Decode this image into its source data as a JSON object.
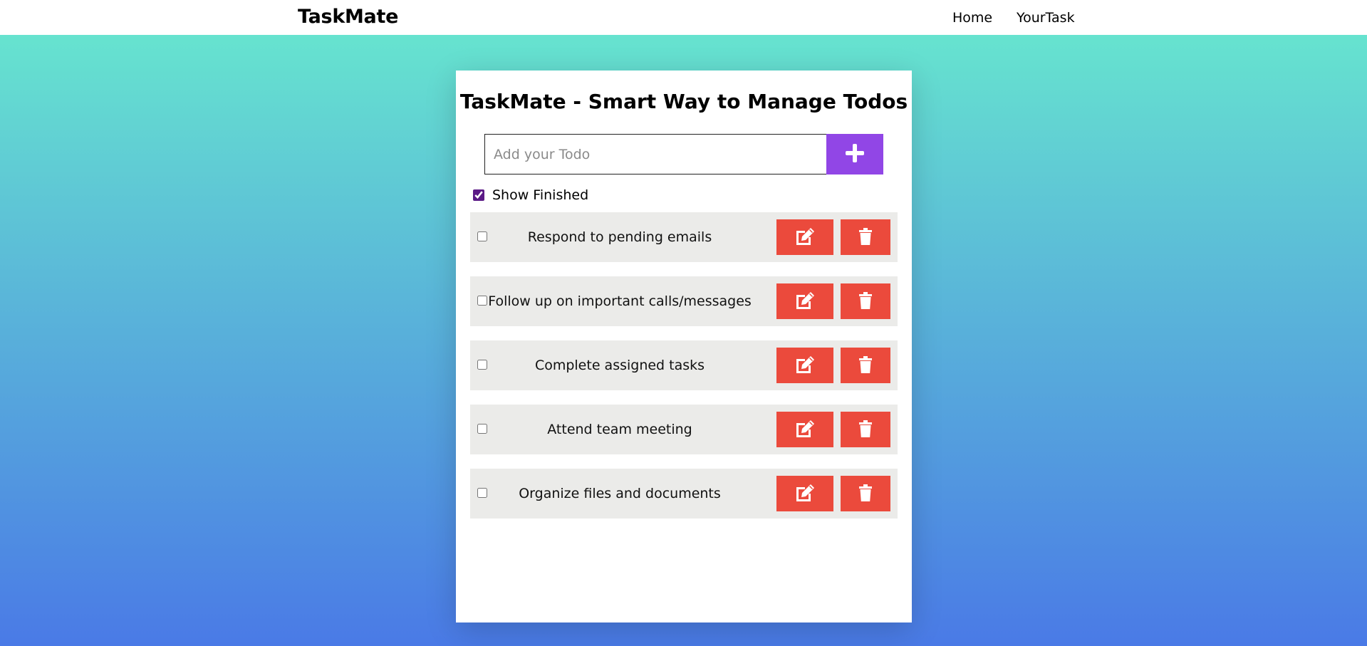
{
  "navbar": {
    "brand": "TaskMate",
    "links": [
      {
        "label": "Home"
      },
      {
        "label": "YourTask"
      }
    ]
  },
  "card": {
    "title": "TaskMate - Smart Way to Manage Todos",
    "input": {
      "placeholder": "Add your Todo",
      "value": ""
    },
    "add_button_icon": "plus-icon",
    "show_finished": {
      "label": "Show Finished",
      "checked": true
    },
    "todos": [
      {
        "text": "Respond to pending emails",
        "done": false
      },
      {
        "text": "Follow up on important calls/messages",
        "done": false
      },
      {
        "text": "Complete assigned tasks",
        "done": false
      },
      {
        "text": "Attend team meeting",
        "done": false
      },
      {
        "text": "Organize files and documents",
        "done": false
      }
    ],
    "edit_icon": "edit-icon",
    "delete_icon": "trash-icon"
  },
  "colors": {
    "gradient_top": "#66e3cf",
    "gradient_bottom": "#4a7ae6",
    "add_button": "#9146e6",
    "action_button": "#eb4a3c",
    "todo_row": "#ebebe9"
  }
}
